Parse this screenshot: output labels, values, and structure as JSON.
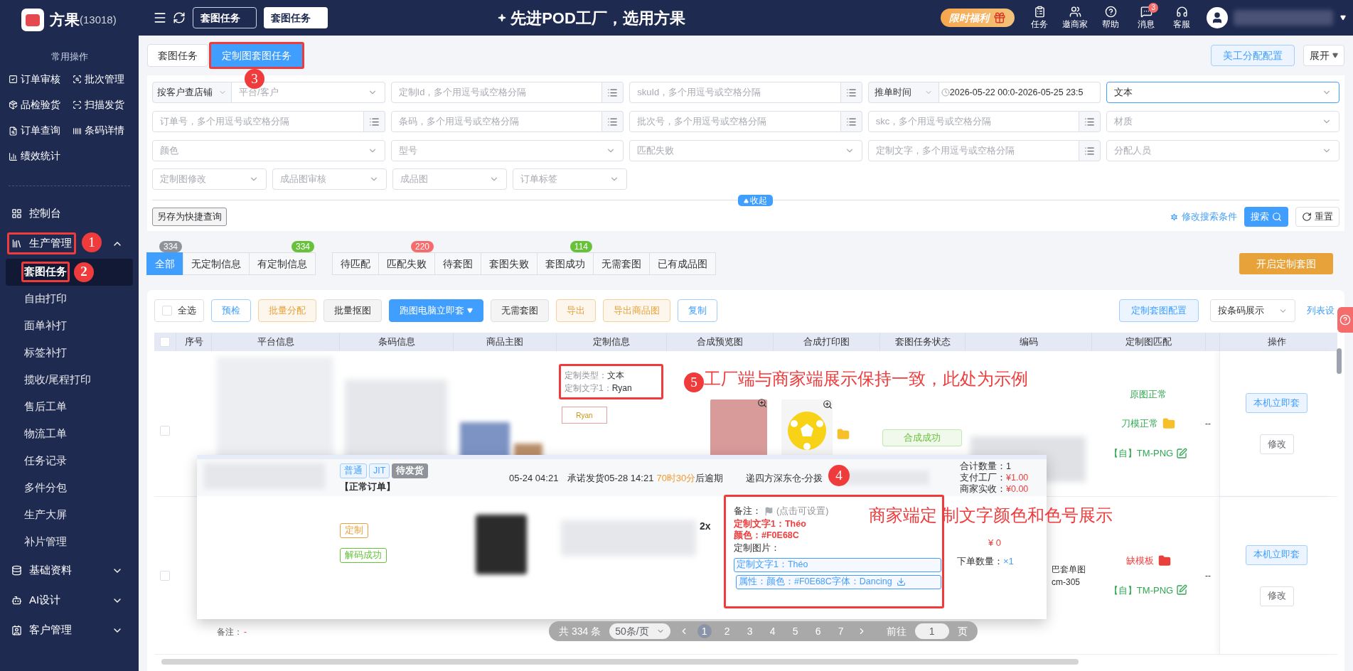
{
  "brand": {
    "name": "方果",
    "code": "(13018)"
  },
  "top_tabs": [
    {
      "label": "套图任务",
      "selected": false
    },
    {
      "label": "套图任务",
      "selected": true
    }
  ],
  "slogan": "先进POD工厂，选用方果",
  "promo": "限时福利",
  "top_actions": [
    {
      "kind": "task",
      "label": "任务"
    },
    {
      "kind": "invite",
      "label": "邀商家"
    },
    {
      "kind": "help",
      "label": "帮助"
    },
    {
      "kind": "message",
      "label": "消息",
      "badge": "3"
    },
    {
      "kind": "service",
      "label": "客服"
    }
  ],
  "sidebar": {
    "section_title": "常用操作",
    "quick_ops": [
      {
        "kind": "check",
        "label": "订单审核"
      },
      {
        "kind": "batch",
        "label": "批次管理"
      },
      {
        "kind": "inspect",
        "label": "品检验货"
      },
      {
        "kind": "scan",
        "label": "扫描发货"
      },
      {
        "kind": "query",
        "label": "订单查询"
      },
      {
        "kind": "barcode",
        "label": "条码详情"
      },
      {
        "kind": "stats",
        "label": "绩效统计"
      }
    ],
    "nav": [
      {
        "kind": "dashboard",
        "label": "控制台"
      },
      {
        "kind": "production",
        "label": "生产管理",
        "expanded": true,
        "children": [
          {
            "label": "套图任务",
            "selected": true
          },
          {
            "label": "自由打印",
            "selected": false
          },
          {
            "label": "面单补打",
            "selected": false
          },
          {
            "label": "标签补打",
            "selected": false
          },
          {
            "label": "揽收/尾程打印",
            "selected": false
          },
          {
            "label": "售后工单",
            "selected": false
          },
          {
            "label": "物流工单",
            "selected": false
          },
          {
            "label": "任务记录",
            "selected": false
          },
          {
            "label": "多件分包",
            "selected": false
          },
          {
            "label": "生产大屏",
            "selected": false
          },
          {
            "label": "补片管理",
            "selected": false
          }
        ]
      },
      {
        "kind": "basic",
        "label": "基础资料",
        "expanded": false
      },
      {
        "kind": "ai",
        "label": "AI设计",
        "expanded": false
      },
      {
        "kind": "customer",
        "label": "客户管理",
        "expanded": false
      }
    ]
  },
  "page_tabs": [
    {
      "label": "套图任务",
      "selected": false
    },
    {
      "label": "定制图套图任务",
      "selected": true
    }
  ],
  "config_button": "美工分配配置",
  "expand_button": "展开",
  "filters": [
    [
      {
        "kind": "prefix_select",
        "prefix": "按客户查店铺",
        "placeholder": "平台/客户"
      },
      {
        "kind": "input",
        "placeholder": "定制Id，多个用逗号或空格分隔"
      },
      {
        "kind": "input",
        "placeholder": "skuId，多个用逗号或空格分隔"
      },
      {
        "kind": "date",
        "prefix": "推单时间",
        "start": "2026-05-22 00:0",
        "separator": "-",
        "end": "2026-05-25 23:5"
      },
      {
        "kind": "select",
        "value": "文本",
        "focused": true
      }
    ],
    [
      {
        "kind": "input",
        "placeholder": "订单号，多个用逗号或空格分隔"
      },
      {
        "kind": "input",
        "placeholder": "条码，多个用逗号或空格分隔"
      },
      {
        "kind": "input",
        "placeholder": "批次号，多个用逗号或空格分隔"
      },
      {
        "kind": "input",
        "placeholder": "skc，多个用逗号或空格分隔"
      },
      {
        "kind": "select",
        "placeholder": "材质"
      }
    ],
    [
      {
        "kind": "select",
        "placeholder": "颜色"
      },
      {
        "kind": "select",
        "placeholder": "型号"
      },
      {
        "kind": "select",
        "placeholder": "匹配失败"
      },
      {
        "kind": "input",
        "placeholder": "定制文字，多个用逗号或空格分隔"
      },
      {
        "kind": "select",
        "placeholder": "分配人员"
      }
    ],
    [
      {
        "kind": "select",
        "placeholder": "定制图修改"
      },
      {
        "kind": "select",
        "placeholder": "成品图审核"
      },
      {
        "kind": "select",
        "placeholder": "成品图"
      },
      {
        "kind": "select",
        "placeholder": "订单标签"
      }
    ]
  ],
  "save_query": "另存为快捷查询",
  "collapse": "收起",
  "edit_conditions": "修改搜索条件",
  "search": "搜索",
  "reset": "重置",
  "status_groups": [
    [
      {
        "label": "全部",
        "selected": true,
        "badge": "334",
        "color": "#909399"
      },
      {
        "label": "无定制信息",
        "selected": false
      },
      {
        "label": "有定制信息",
        "selected": false,
        "badge": "334",
        "color": "#67c23a"
      }
    ],
    [
      {
        "label": "待匹配",
        "selected": false
      },
      {
        "label": "匹配失败",
        "selected": false,
        "badge": "220",
        "color": "#f56c6c"
      },
      {
        "label": "待套图",
        "selected": false
      },
      {
        "label": "套图失败",
        "selected": false
      },
      {
        "label": "套图成功",
        "selected": false,
        "badge": "114",
        "color": "#67c23a"
      },
      {
        "label": "无需套图",
        "selected": false
      },
      {
        "label": "已有成品图",
        "selected": false
      }
    ]
  ],
  "start_button": "开启定制套图",
  "select_all": {
    "label": "全选",
    "checked": false
  },
  "header_checked": false,
  "toolbar": [
    {
      "kind": "outline",
      "label": "预检"
    },
    {
      "kind": "warning",
      "label": "批量分配"
    },
    {
      "kind": "plain",
      "label": "批量抠图"
    },
    {
      "kind": "primary",
      "label": "跑图电脑立即套",
      "dropdown": true
    },
    {
      "kind": "plain",
      "label": "无需套图"
    },
    {
      "kind": "warning",
      "label": "导出"
    },
    {
      "kind": "warning",
      "label": "导出商品图"
    },
    {
      "kind": "outline",
      "label": "复制"
    }
  ],
  "toolbar_right": {
    "config": "定制套图配置",
    "display": "按条码展示",
    "settings": "列表设"
  },
  "columns": [
    "序号",
    "平台信息",
    "条码信息",
    "商品主图",
    "定制信息",
    "合成预览图",
    "合成打印图",
    "套图任务状态",
    "编码",
    "定制图匹配",
    "",
    "操作"
  ],
  "rows": [
    {
      "checked": false,
      "custom_info": [
        {
          "label": "定制类型：",
          "value": "文本"
        },
        {
          "label": "定制文字1：",
          "value": "Ryan"
        }
      ],
      "thumbnail_text": "Ryan",
      "status": "合成成功",
      "match": [
        {
          "label": "原图正常",
          "ok": true,
          "folder": false
        },
        {
          "label": "刀模正常",
          "ok": true,
          "folder": true
        }
      ],
      "template": "【自】TM-PNG",
      "column_11": "--",
      "ops": [
        "本机立即套",
        "修改"
      ]
    },
    {
      "checked": false,
      "remark_label": "备注：",
      "remark_value": "-",
      "code_lines": [
        "巴套单图",
        "cm-305"
      ],
      "match": [
        {
          "label": "缺模板",
          "ok": false,
          "folder": true
        }
      ],
      "template": "【自】TM-PNG",
      "column_11": "--",
      "ops": [
        "本机立即套",
        "修改"
      ]
    }
  ],
  "order_card": {
    "tags": [
      {
        "kind": "blue",
        "label": "普通"
      },
      {
        "kind": "blue",
        "label": "JIT"
      },
      {
        "kind": "gray",
        "label": "待发货"
      }
    ],
    "order_type": "【正常订单】",
    "date": "05-24 04:21",
    "commit": "承诺发货05-28 14:21",
    "countdown": "70时30分",
    "countdown_suffix": "后逾期",
    "warehouse": "递四方深东仓-分拨",
    "stats": [
      {
        "label": "合计数量：",
        "value": "1",
        "kind": "plain"
      },
      {
        "label": "支付工厂：",
        "value": "¥1.00",
        "kind": "money"
      },
      {
        "label": "商家实收：",
        "value": "¥0.00",
        "kind": "money"
      }
    ],
    "body_tags": [
      {
        "kind": "orange",
        "label": "定制"
      },
      {
        "kind": "green",
        "label": "解码成功"
      }
    ],
    "quantity": "2x",
    "remark_label": "备注：",
    "remark_hint": "(点击可设置)",
    "custom_lines": [
      "定制文字1：Théo",
      "颜色：#F0E68C"
    ],
    "image_label": "定制图片：",
    "custom_boxes": [
      {
        "label": "定制文字1：Théo",
        "download": false
      },
      {
        "label": "属性：颜色：#F0E68C字体：Dancing",
        "download": true
      }
    ],
    "price": "¥ 0",
    "order_qty_label": "下单数量：",
    "order_qty": "×1"
  },
  "pagination": {
    "total": "共 334 条",
    "page_size": "50条/页",
    "pages": [
      {
        "label": "1",
        "selected": true
      },
      {
        "label": "2",
        "selected": false
      },
      {
        "label": "3",
        "selected": false
      },
      {
        "label": "4",
        "selected": false
      },
      {
        "label": "5",
        "selected": false
      },
      {
        "label": "6",
        "selected": false
      },
      {
        "label": "7",
        "selected": false
      }
    ],
    "goto_label": "前往",
    "goto_value": "1",
    "goto_suffix": "页"
  },
  "annotations": [
    {
      "number": "1"
    },
    {
      "number": "2"
    },
    {
      "number": "3"
    },
    {
      "number": "4",
      "note": "商家端定 制文字颜色和色号展示"
    },
    {
      "number": "5",
      "note": "工厂端与商家端展示保持一致，此处为示例"
    }
  ]
}
